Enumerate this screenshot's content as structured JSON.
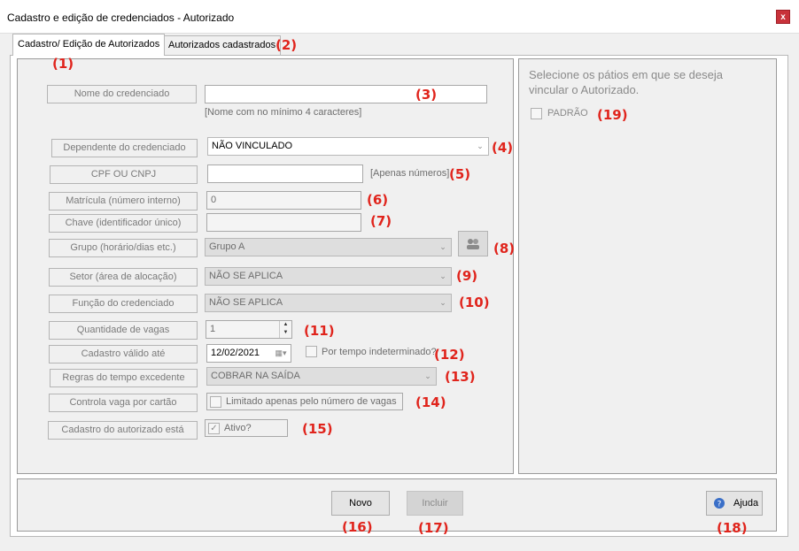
{
  "window": {
    "title": "Cadastro e edição de credenciados - Autorizado",
    "close_label": "x"
  },
  "tabs": [
    {
      "label": "Cadastro/ Edição de Autorizados",
      "active": true
    },
    {
      "label": "Autorizados cadastrados",
      "active": false
    }
  ],
  "form": {
    "nome": {
      "label": "Nome do credenciado",
      "value": "",
      "hint": "[Nome com no mínimo 4 caracteres]"
    },
    "dependente": {
      "label": "Dependente do credenciado",
      "value": "NÃO VINCULADO"
    },
    "cpf": {
      "label": "CPF OU CNPJ",
      "value": "",
      "hint": "[Apenas números]"
    },
    "matricula": {
      "label": "Matrícula (número interno)",
      "value": "0"
    },
    "chave": {
      "label": "Chave (identificador único)",
      "value": ""
    },
    "grupo": {
      "label": "Grupo (horário/dias etc.)",
      "value": "Grupo A"
    },
    "setor": {
      "label": "Setor (área de alocação)",
      "value": "NÃO SE APLICA"
    },
    "funcao": {
      "label": "Função do credenciado",
      "value": "NÃO SE APLICA"
    },
    "vagas": {
      "label": "Quantidade de vagas",
      "value": "1"
    },
    "valido": {
      "label": "Cadastro válido até",
      "value": "12/02/2021",
      "checkbox_label": "Por tempo indeterminado?"
    },
    "regras": {
      "label": "Regras do tempo excedente",
      "value": "COBRAR NA SAÍDA"
    },
    "controla": {
      "label": "Controla vaga por cartão",
      "checkbox_label": "Limitado apenas pelo número de vagas"
    },
    "status": {
      "label": "Cadastro do autorizado está",
      "checkbox_label": "Ativo?",
      "checked": true
    }
  },
  "patios": {
    "instruction": "Selecione os pátios em que se deseja vincular o Autorizado.",
    "items": [
      {
        "label": "PADRÃO",
        "checked": false
      }
    ]
  },
  "buttons": {
    "novo": "Novo",
    "incluir": "Incluir",
    "ajuda": "Ajuda"
  },
  "annotations": [
    "(1)",
    "(2)",
    "(3)",
    "(4)",
    "(5)",
    "(6)",
    "(7)",
    "(8)",
    "(9)",
    "(10)",
    "(11)",
    "(12)",
    "(13)",
    "(14)",
    "(15)",
    "(16)",
    "(17)",
    "(18)",
    "(19)"
  ],
  "colors": {
    "annotation": "#e0241c",
    "close_button": "#c8323a",
    "help_icon": "#3a6fc8"
  }
}
